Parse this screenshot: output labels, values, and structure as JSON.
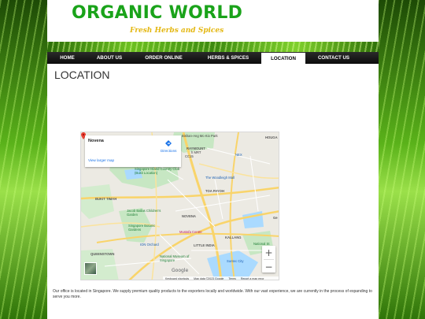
{
  "site": {
    "title": "ORGANIC WORLD",
    "tagline": "Fresh Herbs and Spices"
  },
  "nav": {
    "items": [
      {
        "label": "HOME",
        "active": false
      },
      {
        "label": "ABOUT US",
        "active": false
      },
      {
        "label": "ORDER ONLINE",
        "active": false
      },
      {
        "label": "HERBS & SPICES",
        "active": false
      },
      {
        "label": "LOCATION",
        "active": true
      },
      {
        "label": "CONTACT US",
        "active": false
      }
    ]
  },
  "page": {
    "title": "LOCATION"
  },
  "map": {
    "place_name": "Novena",
    "directions_label": "Directions",
    "larger_map_label": "View larger map",
    "zoom_in": "+",
    "zoom_out": "−",
    "google_logo": "Google",
    "footer": {
      "shortcuts": "Keyboard shortcuts",
      "map_data": "Map data ©2023 Google",
      "terms": "Terms",
      "report": "Report a map error"
    },
    "labels": {
      "ang_mo_kio_park": "Bishan-Ang Mo Kio Park",
      "raymount": "RAYMOUNT",
      "mrt": "h MRT",
      "cc15": "CC15",
      "hougang": "HOUGA",
      "nex": "NEX",
      "island_cc": "Singapore Island Country Club (Bukit Location)",
      "woodleigh": "The Woodleigh Mall",
      "toa_payoh": "TOA PAYOH",
      "bukit_timah": "BUKIT TIMAH",
      "jacob_ballas": "Jacob Ballas Children's Garden",
      "botanic": "Singapore Botanic Gardens",
      "novena": "NOVENA",
      "mustafa": "Mustafa Centre",
      "ion": "ION Orchard",
      "little_india": "LITTLE INDIA",
      "kallang": "KALLANG",
      "national_stadium": "National St",
      "museum": "National Museum of Singapore",
      "suntec": "Suntec City",
      "queenstown": "QUEENSTOWN",
      "forest": "Ge"
    }
  },
  "footer_text": "Our office is located in Singapore. We supply premium quality products to the exporters locally and worldwide. With our vast experience, we are currently in the process of expanding to serve you more.",
  "colors": {
    "brand_green": "#1aa31a",
    "tagline_gold": "#e4b814",
    "nav_bg": "#111111",
    "map_link": "#1a73e8"
  }
}
